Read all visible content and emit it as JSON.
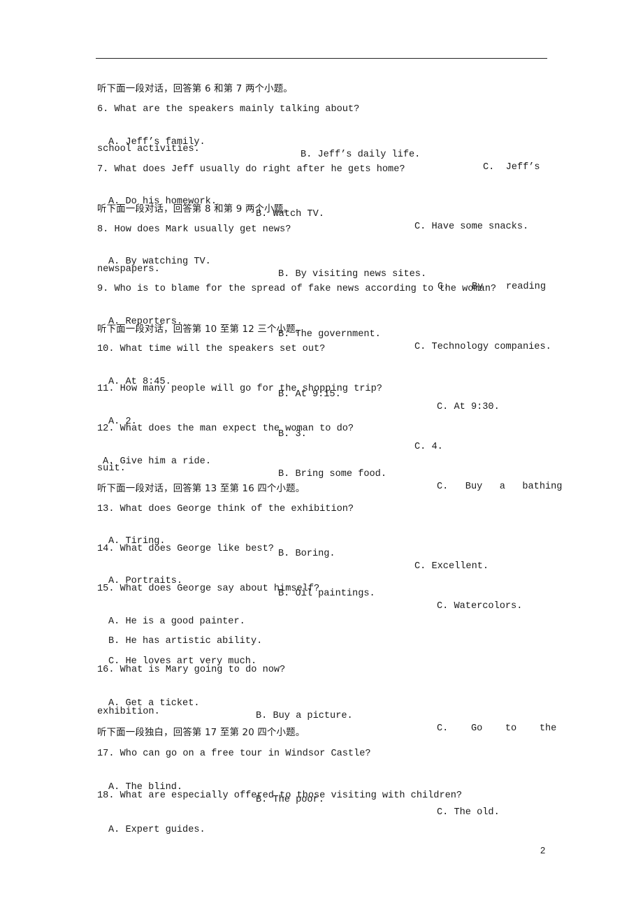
{
  "page_number": "2",
  "sections": [
    {
      "instruction": "听下面一段对话，回答第 6 和第 7 两个小题。"
    },
    {
      "instruction": "听下面一段对话，回答第 8 和第 9 两个小题。"
    },
    {
      "instruction": "听下面一段对话，回答第 10 至第 12 三个小题。"
    },
    {
      "instruction": "听下面一段对话，回答第 13 至第 16 四个小题。"
    },
    {
      "instruction": "听下面一段独白，回答第 17 至第 20 四个小题。"
    }
  ],
  "questions": {
    "q6": {
      "stem": "6. What are the speakers mainly talking about?",
      "a": "A. Jeff’s family.",
      "b": "B. Jeff’s daily life.",
      "c": "C.  Jeff’s",
      "c_cont": "school activities."
    },
    "q7": {
      "stem": "7. What does Jeff usually do right after he gets home?",
      "a": "A. Do his homework.",
      "b": "B. Watch TV.",
      "c": "C. Have some snacks."
    },
    "q8": {
      "stem": "8. How does Mark usually get news?",
      "a": "A. By watching TV.",
      "b": "B. By visiting news sites.",
      "c": "C.    By    reading",
      "c_cont": "newspapers."
    },
    "q9": {
      "stem": "9. Who is to blame for the spread of fake news according to the woman?",
      "a": "A. Reporters.",
      "b": "B. The government.",
      "c": "C. Technology companies."
    },
    "q10": {
      "stem": "10. What time will the speakers set out?",
      "a": "A. At 8:45.",
      "b": "B. At 9:15.",
      "c": "C. At 9:30."
    },
    "q11": {
      "stem": "11. How many people will go for the shopping trip?",
      "a": "A. 2.",
      "b": "B. 3.",
      "c": "C. 4."
    },
    "q12": {
      "stem": "12. What does the man expect the woman to do?",
      "a": "A. Give him a ride.",
      "b": "B. Bring some food.",
      "c": "C.   Buy   a   bathing",
      "c_cont": "suit."
    },
    "q13": {
      "stem": "13. What does George think of the exhibition?",
      "a": "A. Tiring.",
      "b": "B. Boring.",
      "c": "C. Excellent."
    },
    "q14": {
      "stem": "14. What does George like best?",
      "a": "A. Portraits.",
      "b": "B. Oil paintings.",
      "c": "C. Watercolors."
    },
    "q15": {
      "stem": "15. What does George say about himself?",
      "a": "A. He is a good painter.",
      "b": "B. He has artistic ability.",
      "c": "C. He loves art very much."
    },
    "q16": {
      "stem": "16. What is Mary going to do now?",
      "a": "A. Get a ticket.",
      "b": "B. Buy a picture.",
      "c": "C.    Go    to    the",
      "c_cont": "exhibition."
    },
    "q17": {
      "stem": "17. Who can go on a free tour in Windsor Castle?",
      "a": "A. The blind.",
      "b": "B. The poor.",
      "c": "C. The old."
    },
    "q18": {
      "stem": "18. What are especially offered to those visiting with children?",
      "a": "A. Expert guides."
    }
  }
}
